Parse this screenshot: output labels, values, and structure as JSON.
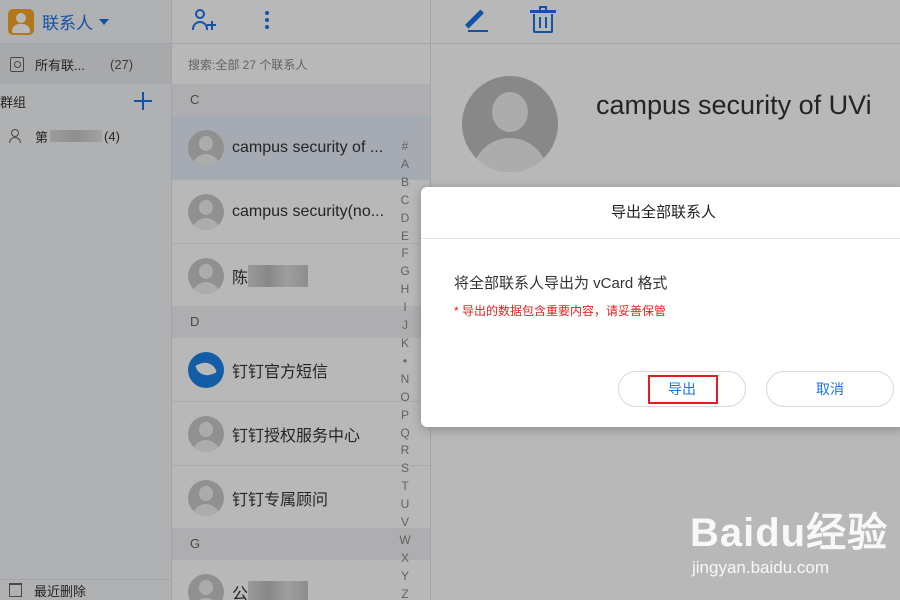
{
  "app": {
    "title": "联系人"
  },
  "sidebar": {
    "all_contacts": {
      "label": "所有联...",
      "count": "(27)"
    },
    "groups_label": "群组",
    "group": {
      "prefix": "第",
      "count": "(4)"
    },
    "recently_deleted": "最近删除"
  },
  "list": {
    "search_hint": "搜索:全部 27 个联系人",
    "sections": [
      "C",
      "D",
      "G"
    ],
    "rows": [
      {
        "name": "campus security of ..."
      },
      {
        "name": "campus security(no..."
      },
      {
        "name": "陈"
      },
      {
        "name": "钉钉官方短信"
      },
      {
        "name": "钉钉授权服务中心"
      },
      {
        "name": "钉钉专属顾问"
      },
      {
        "name": "公"
      }
    ],
    "alpha_index": [
      "#",
      "A",
      "B",
      "C",
      "D",
      "E",
      "F",
      "G",
      "H",
      "I",
      "J",
      "K",
      "•",
      "N",
      "O",
      "P",
      "Q",
      "R",
      "S",
      "T",
      "U",
      "V",
      "W",
      "X",
      "Y",
      "Z"
    ]
  },
  "detail": {
    "name": "campus security of UVi"
  },
  "dialog": {
    "title": "导出全部联系人",
    "message": "将全部联系人导出为 vCard 格式",
    "warning": "* 导出的数据包含重要内容，请妥善保管",
    "export_label": "导出",
    "cancel_label": "取消"
  },
  "watermark": {
    "brand": "Baidu经验",
    "url": "jingyan.baidu.com"
  },
  "colors": {
    "accent": "#1a73e8",
    "warning": "#e02020",
    "overlay": "rgba(0,0,0,0.28)"
  }
}
